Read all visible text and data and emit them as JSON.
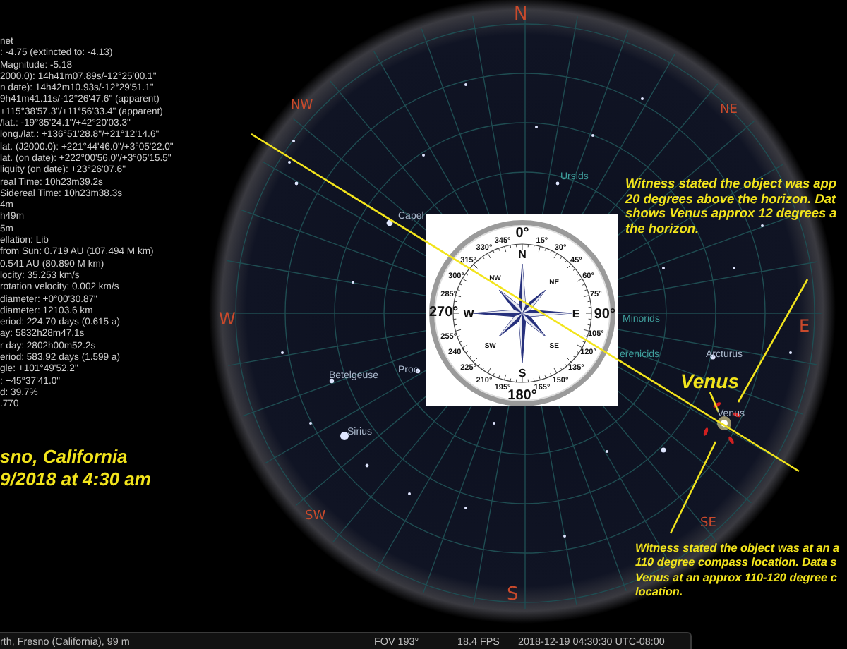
{
  "info_panel": {
    "lines": [
      "net",
      ": -4.75 (extincted to: -4.13)",
      "Magnitude: -5.18",
      "2000.0): 14h41m07.89s/-12°25'00.1\"",
      "n date): 14h42m10.93s/-12°29'51.1\"",
      "9h41m41.11s/-12°26'47.6\" (apparent)",
      "+115°38'57.3\"/+11°56'33.4\" (apparent)",
      "/lat.: -19°35'24.1\"/+42°20'03.3\"",
      "long./lat.: +136°51'28.8\"/+21°12'14.6\"",
      "lat. (J2000.0): +221°44'46.0\"/+3°05'22.0\"",
      "lat. (on date): +222°00'56.0\"/+3°05'15.5\"",
      "liquity (on date): +23°26'07.6\"",
      "real Time: 10h23m39.2s",
      "Sidereal Time: 10h23m38.3s",
      "4m",
      "h49m",
      "5m",
      "ellation: Lib",
      "from Sun: 0.719 AU (107.494 M km)",
      "0.541 AU (80.890 M km)",
      "locity: 35.253 km/s",
      "rotation velocity: 0.002 km/s",
      "diameter: +0°00'30.87\"",
      "diameter: 12103.6 km",
      "eriod: 224.70 days (0.615 a)",
      "ay: 5832h28m47.1s",
      "r day: 2802h00m52.2s",
      "eriod: 583.92 days (1.599 a)",
      "gle: +101°49'52.2\"",
      ": +45°37'41.0\"",
      "d: 39.7%",
      ".770"
    ]
  },
  "sky": {
    "cardinals": [
      "N",
      "NE",
      "E",
      "SE",
      "S",
      "SW",
      "W",
      "NW"
    ],
    "object_labels": [
      {
        "text": "Capel",
        "kind": "star"
      },
      {
        "text": "Betelgeuse",
        "kind": "star"
      },
      {
        "text": "Proc",
        "kind": "star"
      },
      {
        "text": "Sirius",
        "kind": "star"
      },
      {
        "text": "Ursids",
        "kind": "shower"
      },
      {
        "text": "Minorids",
        "kind": "shower"
      },
      {
        "text": "erenicids",
        "kind": "shower"
      },
      {
        "text": "Arcturus",
        "kind": "star"
      },
      {
        "text": "Venus",
        "kind": "star"
      }
    ]
  },
  "compass": {
    "right_half_degree_labels": [
      "0°",
      "15°",
      "30°",
      "45°",
      "60°",
      "75°",
      "90°",
      "105°",
      "120°",
      "135°",
      "150°",
      "165°",
      "180°"
    ],
    "left_half_degree_labels": [
      "345°",
      "330°",
      "315°",
      "300°",
      "285°",
      "270°",
      "255°",
      "240°",
      "225°",
      "210°",
      "195°"
    ],
    "rose_labels": [
      "N",
      "NE",
      "E",
      "SE",
      "S",
      "SW",
      "W",
      "NW"
    ]
  },
  "target_label": "Venus",
  "location_caption": {
    "lines": [
      "sno, California",
      "9/2018 at 4:30 am"
    ]
  },
  "annotations": [
    {
      "lines": [
        "Witness stated the object was app",
        "20 degrees above the horizon. Dat",
        "shows Venus approx 12 degrees a",
        "the horizon."
      ]
    },
    {
      "lines": [
        "Witness stated the object was at an a",
        "110 degree compass location. Data s",
        "Venus at an approx 110-120 degree c",
        "location."
      ]
    }
  ],
  "status_bar": {
    "location": "rth, Fresno (California), 99 m",
    "fov": "FOV 193°",
    "fps": "18.4 FPS",
    "datetime": "2018-12-19 04:30:30 UTC-08:00"
  }
}
